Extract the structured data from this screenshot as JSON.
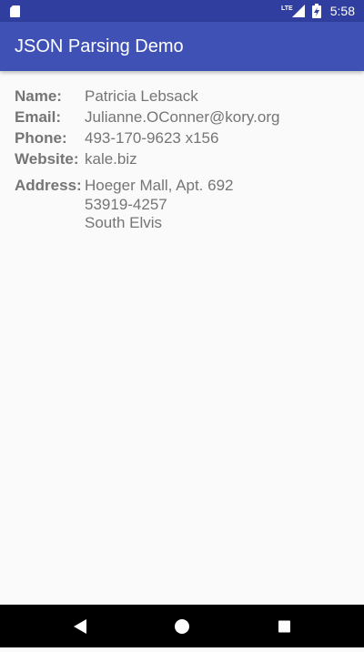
{
  "status_bar": {
    "network": "LTE",
    "time": "5:58"
  },
  "app_bar": {
    "title": "JSON Parsing Demo"
  },
  "profile": {
    "name_label": "Name:",
    "name": "Patricia Lebsack",
    "email_label": "Email:",
    "email": "Julianne.OConner@kory.org",
    "phone_label": "Phone:",
    "phone": "493-170-9623 x156",
    "website_label": "Website:",
    "website": "kale.biz",
    "address_label": "Address:",
    "address_lines": [
      "Hoeger Mall, Apt. 692",
      "53919-4257",
      "South Elvis"
    ]
  },
  "colors": {
    "primary": "#3f51b5",
    "primary_dark": "#303f9f",
    "label_text": "#757575",
    "background": "#fafafa"
  },
  "icons": {
    "status_left": "sd-card-icon",
    "status_right": [
      "lte-icon",
      "signal-icon",
      "battery-charging-icon"
    ],
    "nav": [
      "back-icon",
      "home-icon",
      "recents-icon"
    ]
  }
}
